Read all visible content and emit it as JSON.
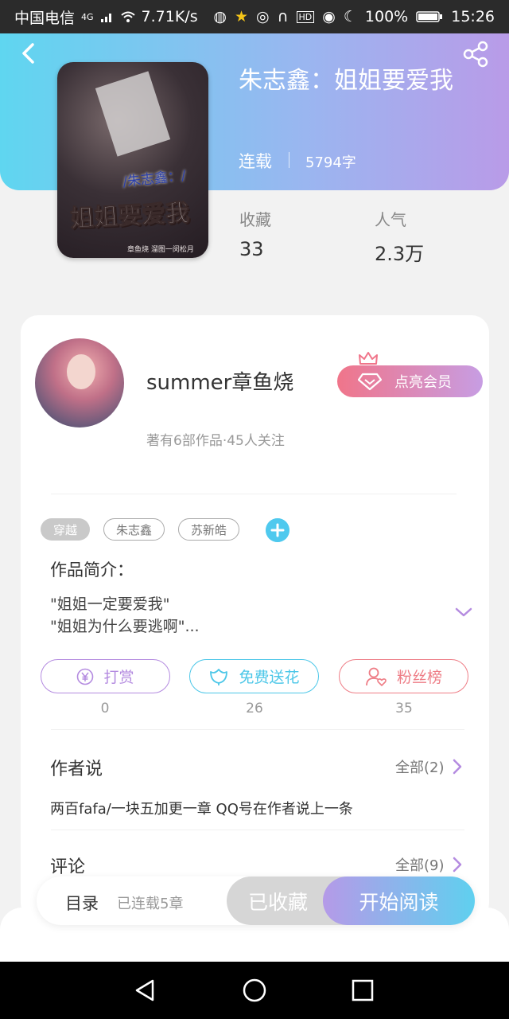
{
  "status_bar": {
    "carrier": "中国电信",
    "network": "4G",
    "speed": "7.71K/s",
    "battery": "100%",
    "time": "15:26"
  },
  "header": {
    "book_title": "朱志鑫：姐姐要爱我",
    "status": "连载",
    "word_count": "5794字",
    "cover": {
      "subtitle": "/朱志鑫：/",
      "title": "姐姐要爱我",
      "credit": "章鱼烧  溜图一闵松月"
    },
    "stats": [
      {
        "label": "收藏",
        "value": "33"
      },
      {
        "label": "人气",
        "value": "2.3万"
      }
    ]
  },
  "author": {
    "name": "summer章鱼烧",
    "meta": "著有6部作品·45人关注",
    "vip_label": "点亮会员"
  },
  "tags": [
    "穿越",
    "朱志鑫",
    "苏新皓"
  ],
  "intro": {
    "title": "作品简介：",
    "lines": [
      "\"姐姐一定要爱我\"",
      "\"姐姐为什么要逃啊\"..."
    ]
  },
  "actions": [
    {
      "label": "打赏",
      "count": "0",
      "color": "#b48be0"
    },
    {
      "label": "免费送花",
      "count": "26",
      "color": "#4cc7e8"
    },
    {
      "label": "粉丝榜",
      "count": "35",
      "color": "#ee7d86"
    }
  ],
  "author_say": {
    "title": "作者说",
    "more": "全部(2)",
    "note": "两百fafa/一块五加更一章 QQ号在作者说上一条"
  },
  "comments": {
    "title": "评论",
    "more": "全部(9)"
  },
  "bottom_bar": {
    "toc": "目录",
    "toc_sub": "已连载5章",
    "collected": "已收藏",
    "start_reading": "开始阅读"
  }
}
